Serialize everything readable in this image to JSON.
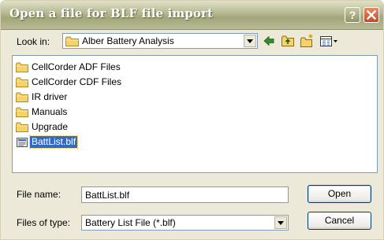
{
  "window": {
    "title": "Open a file for BLF file import"
  },
  "lookin": {
    "label": "Look in:",
    "value": "Alber Battery Analysis"
  },
  "toolbar": {
    "icons": [
      "back-arrow-icon",
      "up-folder-icon",
      "new-folder-icon",
      "view-menu-icon"
    ]
  },
  "files": [
    {
      "name": "CellCorder ADF Files",
      "kind": "folder"
    },
    {
      "name": "CellCorder CDF Files",
      "kind": "folder"
    },
    {
      "name": "IR driver",
      "kind": "folder"
    },
    {
      "name": "Manuals",
      "kind": "folder"
    },
    {
      "name": "Upgrade",
      "kind": "folder"
    },
    {
      "name": "BattList.blf",
      "kind": "file",
      "selected": true
    }
  ],
  "filename": {
    "label": "File name:",
    "value": "BattList.blf"
  },
  "filetype": {
    "label": "Files of type:",
    "value": "Battery List File (*.blf)"
  },
  "buttons": {
    "open": "Open",
    "cancel": "Cancel"
  },
  "colors": {
    "selection": "#316ac5",
    "close_button": "#c24a24",
    "titlebar": "#a3a67a"
  }
}
